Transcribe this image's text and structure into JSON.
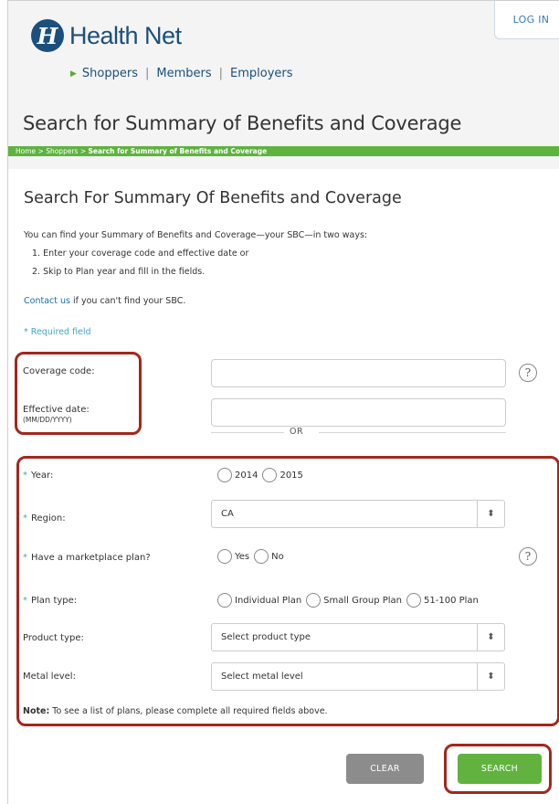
{
  "header": {
    "brand": "Health Net",
    "brand_mark": "H",
    "login_label": "LOG IN",
    "nav": [
      "Shoppers",
      "Members",
      "Employers"
    ],
    "page_title": "Search for Summary of Benefits and Coverage",
    "breadcrumb_prefix": "Home > Shoppers > ",
    "breadcrumb_current": "Search for Summary of Benefits and Coverage"
  },
  "intro": {
    "heading": "Search For Summary Of Benefits and Coverage",
    "lead": "You can find your Summary of Benefits and Coverage—your SBC—in two ways:",
    "step1": "1.  Enter your coverage code and effective date or",
    "step2": "2.  Skip to Plan year and fill in the fields.",
    "contact_link": "Contact us",
    "contact_rest": " if you can't find your SBC.",
    "required_note": "* Required field"
  },
  "form": {
    "coverage_code_label": "Coverage code:",
    "effective_date_label": "Effective date:",
    "effective_date_hint": "(MM/DD/YYYY)",
    "or_text": "OR",
    "year_label": "Year:",
    "year_options": [
      "2014",
      "2015"
    ],
    "region_label": "Region:",
    "region_value": "CA",
    "marketplace_label": "Have a marketplace plan?",
    "marketplace_options": [
      "Yes",
      "No"
    ],
    "plan_type_label": "Plan type:",
    "plan_type_options": [
      "Individual Plan",
      "Small Group Plan",
      "51-100 Plan"
    ],
    "product_type_label": "Product type:",
    "product_type_placeholder": "Select product type",
    "metal_level_label": "Metal level:",
    "metal_level_placeholder": "Select metal level",
    "note_bold": "Note:",
    "note_text": " To see a list of plans, please complete all required fields above.",
    "help_glyph": "?",
    "caret_glyph": "⬍",
    "star": "*"
  },
  "buttons": {
    "clear": "CLEAR",
    "search": "SEARCH"
  },
  "colors": {
    "brand_blue": "#1b4f7c",
    "green": "#5db33d",
    "highlight_red": "#a3271c",
    "required_blue": "#3da6c8"
  }
}
